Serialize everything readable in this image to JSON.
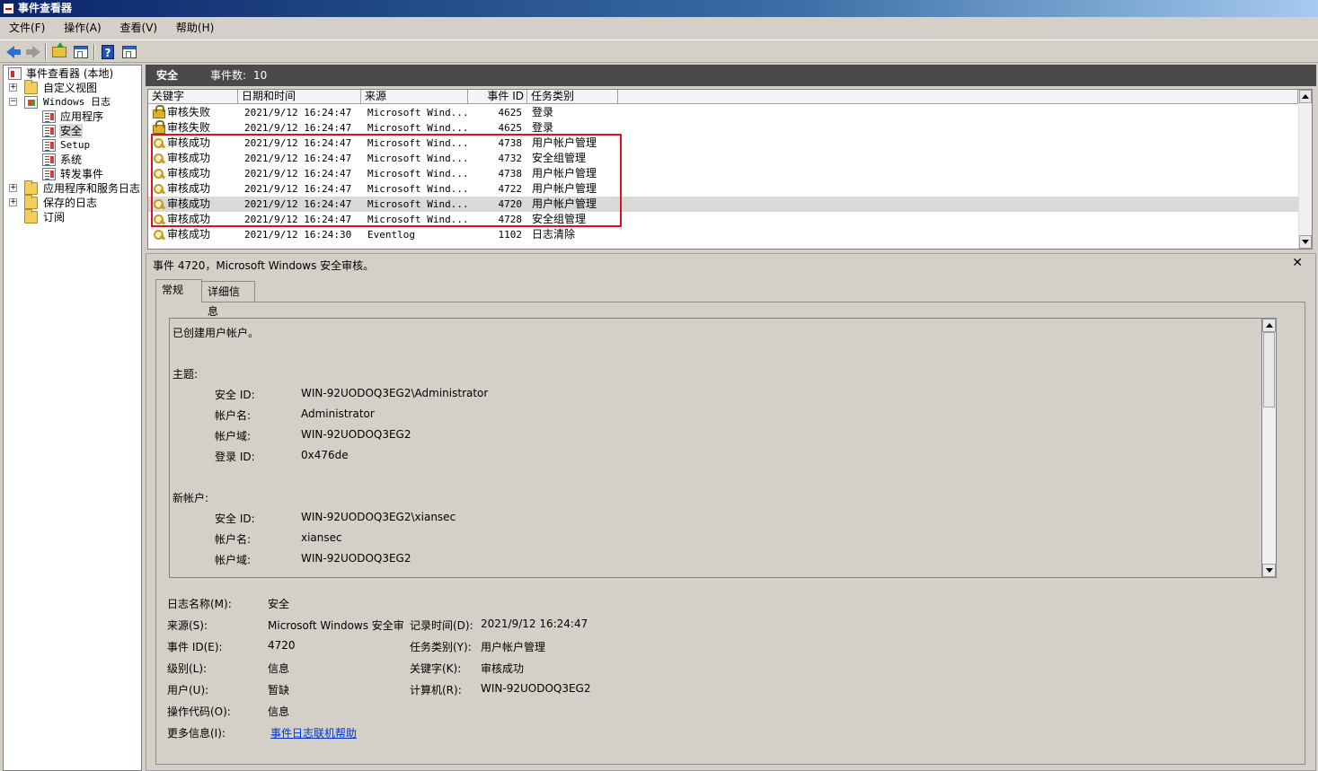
{
  "window": {
    "title": "事件查看器"
  },
  "menu": [
    "文件(F)",
    "操作(A)",
    "查看(V)",
    "帮助(H)"
  ],
  "toolbar": {
    "buttons": [
      "back-arrow-icon",
      "forward-arrow-icon",
      "folder-up-icon",
      "show-hide-console-tree-icon",
      "help-icon",
      "show-hide-action-pane-icon"
    ]
  },
  "tree": {
    "root": "事件查看器 (本地)",
    "custom_views": "自定义视图",
    "windows_logs": "Windows 日志",
    "application": "应用程序",
    "security": "安全",
    "setup": "Setup",
    "system": "系统",
    "forwarded": "转发事件",
    "app_service_logs": "应用程序和服务日志",
    "saved_logs": "保存的日志",
    "subscriptions": "订阅"
  },
  "pane": {
    "name": "安全",
    "count_label": "事件数:",
    "count": "10"
  },
  "columns": [
    "关键字",
    "日期和时间",
    "来源",
    "事件 ID",
    "任务类别"
  ],
  "events": [
    {
      "keyword": "审核失败",
      "icon": "lock-icon",
      "datetime": "2021/9/12 16:24:47",
      "source": "Microsoft Wind...",
      "id": "4625",
      "category": "登录"
    },
    {
      "keyword": "审核失败",
      "icon": "lock-icon",
      "datetime": "2021/9/12 16:24:47",
      "source": "Microsoft Wind...",
      "id": "4625",
      "category": "登录"
    },
    {
      "keyword": "审核成功",
      "icon": "key-icon",
      "datetime": "2021/9/12 16:24:47",
      "source": "Microsoft Wind...",
      "id": "4738",
      "category": "用户帐户管理"
    },
    {
      "keyword": "审核成功",
      "icon": "key-icon",
      "datetime": "2021/9/12 16:24:47",
      "source": "Microsoft Wind...",
      "id": "4732",
      "category": "安全组管理"
    },
    {
      "keyword": "审核成功",
      "icon": "key-icon",
      "datetime": "2021/9/12 16:24:47",
      "source": "Microsoft Wind...",
      "id": "4738",
      "category": "用户帐户管理"
    },
    {
      "keyword": "审核成功",
      "icon": "key-icon",
      "datetime": "2021/9/12 16:24:47",
      "source": "Microsoft Wind...",
      "id": "4722",
      "category": "用户帐户管理"
    },
    {
      "keyword": "审核成功",
      "icon": "key-icon",
      "datetime": "2021/9/12 16:24:47",
      "source": "Microsoft Wind...",
      "id": "4720",
      "category": "用户帐户管理"
    },
    {
      "keyword": "审核成功",
      "icon": "key-icon",
      "datetime": "2021/9/12 16:24:47",
      "source": "Microsoft Wind...",
      "id": "4728",
      "category": "安全组管理"
    },
    {
      "keyword": "审核成功",
      "icon": "key-icon",
      "datetime": "2021/9/12 16:24:30",
      "source": "Eventlog",
      "id": "1102",
      "category": "日志清除"
    }
  ],
  "selected_event_index": 6,
  "highlight_color": "#e0101c",
  "detail": {
    "title": "事件 4720，Microsoft Windows 安全审核。",
    "close": "✕",
    "tabs": [
      "常规",
      "详细信息"
    ],
    "description": {
      "intro": "已创建用户帐户。",
      "subject_heading": "主题:",
      "subject": [
        {
          "label": "安全 ID:",
          "value": "WIN-92UODOQ3EG2\\Administrator"
        },
        {
          "label": "帐户名:",
          "value": "Administrator"
        },
        {
          "label": "帐户域:",
          "value": "WIN-92UODOQ3EG2"
        },
        {
          "label": "登录 ID:",
          "value": "0x476de"
        }
      ],
      "new_account_heading": "新帐户:",
      "new_account": [
        {
          "label": "安全 ID:",
          "value": "WIN-92UODOQ3EG2\\xiansec"
        },
        {
          "label": "帐户名:",
          "value": "xiansec"
        },
        {
          "label": "帐户域:",
          "value": "WIN-92UODOQ3EG2"
        }
      ]
    },
    "fields": {
      "log_name_label": "日志名称(M):",
      "log_name": "安全",
      "source_label": "来源(S):",
      "source": "Microsoft Windows 安全审",
      "logged_label": "记录时间(D):",
      "logged": "2021/9/12 16:24:47",
      "event_id_label": "事件 ID(E):",
      "event_id": "4720",
      "task_category_label": "任务类别(Y):",
      "task_category": "用户帐户管理",
      "level_label": "级别(L):",
      "level": "信息",
      "keywords_label": "关键字(K):",
      "keywords": "审核成功",
      "user_label": "用户(U):",
      "user": "暂缺",
      "computer_label": "计算机(R):",
      "computer": "WIN-92UODOQ3EG2",
      "opcode_label": "操作代码(O):",
      "opcode": "信息",
      "more_info_label": "更多信息(I):",
      "more_info_link": "事件日志联机帮助"
    }
  }
}
